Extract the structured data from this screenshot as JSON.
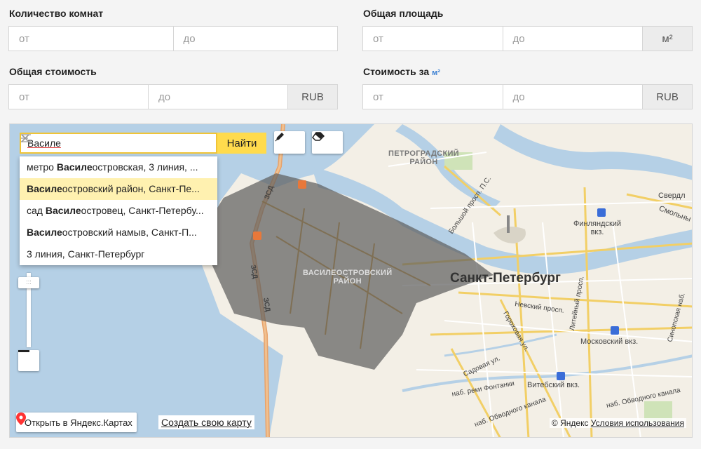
{
  "filters": {
    "rooms": {
      "label": "Количество комнат",
      "from": "от",
      "to": "до"
    },
    "area": {
      "label": "Общая площадь",
      "from": "от",
      "to": "до",
      "unit": "м²"
    },
    "price": {
      "label": "Общая стоимость",
      "from": "от",
      "to": "до",
      "unit": "RUB"
    },
    "price_per": {
      "label": "Стоимость за",
      "label_unit": "м²",
      "from": "от",
      "to": "до",
      "unit": "RUB"
    }
  },
  "map": {
    "search": {
      "value": "Василе",
      "button": "Найти"
    },
    "suggestions": [
      {
        "bold": "",
        "prefix": "метро ",
        "hl": "Василе",
        "rest": "островская, 3 линия, ..."
      },
      {
        "prefix": "",
        "hl": "Василе",
        "rest": "островский район, Санкт-Пе..."
      },
      {
        "prefix": "сад ",
        "hl": "Василе",
        "rest": "островец, Санкт-Петербу..."
      },
      {
        "prefix": "",
        "hl": "Василе",
        "rest": "островский намыв, Санкт-П..."
      },
      {
        "prefix": "",
        "hl": "",
        "rest": "3 линия, Санкт-Петербург"
      }
    ],
    "labels": {
      "district_1": "ПЕТРОГРАДСКИЙ",
      "district_2": "РАЙОН",
      "vo_1": "ВАСИЛЕОСТРОВСКИЙ",
      "vo_2": "РАЙОН",
      "city": "Санкт-Петербург",
      "finland_1": "Финляндский",
      "finland_2": "вкз.",
      "moscow": "Московский вкз.",
      "vitebsk": "Витебский вкз.",
      "nevsky": "Невский просп.",
      "liteyny": "Литейный просп.",
      "bolshoy": "Большой просп. П.С.",
      "sadovaya": "Садовая ул.",
      "gorokhovaya": "Гороховая ул.",
      "fontanka": "наб. реки Фонтанки",
      "obvodny": "наб. Обводного канала",
      "obvodny2": "наб. Обводного канала",
      "sverdl": "Свердл",
      "smolny": "Смольны",
      "sinop": "Синопская наб.",
      "zsd": "ЗСД"
    },
    "zoom": {
      "minus": "—",
      "handle": ":::"
    },
    "open_button": "Открыть в Яндекс.Картах",
    "create_link": "Создать свою карту",
    "copyright": "© Яндекс",
    "terms": "Условия использования"
  }
}
